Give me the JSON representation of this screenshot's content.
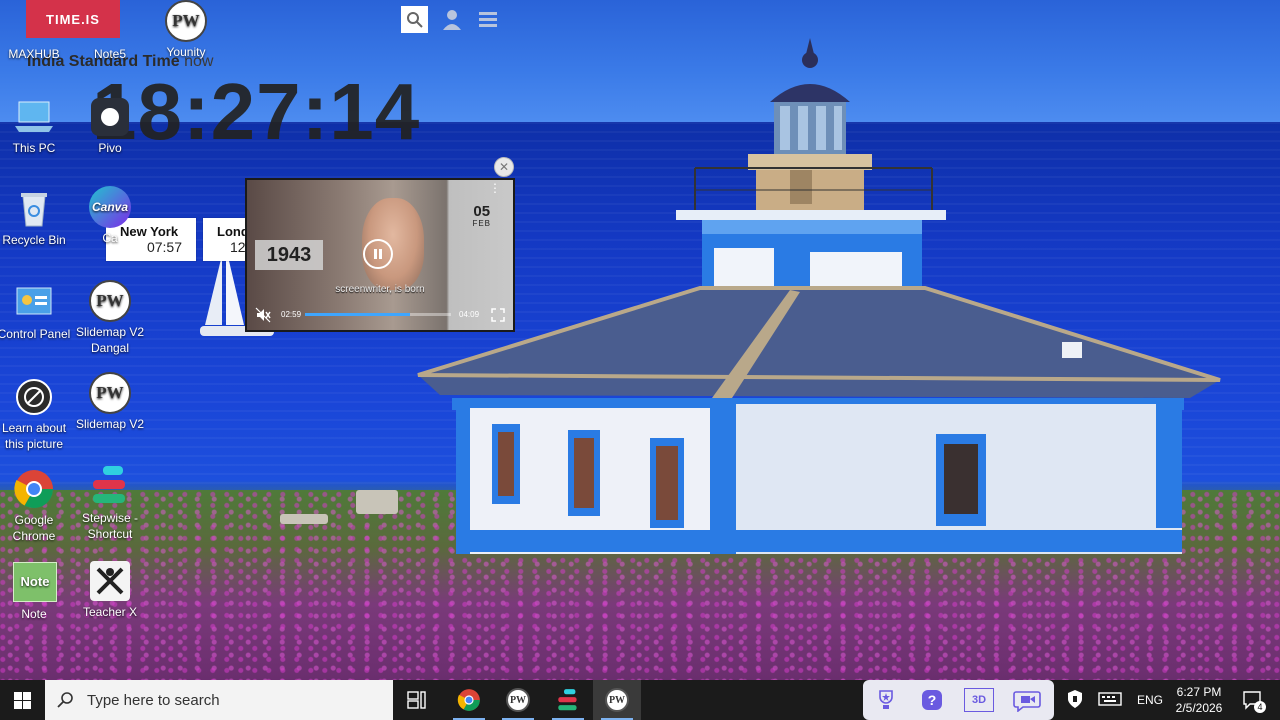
{
  "timeis": {
    "logo": "TIME.IS",
    "timezone": "India Standard Time",
    "now_label": "now",
    "clock": "18:27:14",
    "cities": [
      {
        "name": "New York",
        "time": "07:57"
      },
      {
        "name": "Lond",
        "time": "12"
      }
    ]
  },
  "desktop_icons": [
    {
      "label": "MAXHUB"
    },
    {
      "label": "Note5"
    },
    {
      "label": "Younity"
    },
    {
      "label": "This PC"
    },
    {
      "label": "Pivo"
    },
    {
      "label": "Recycle Bin"
    },
    {
      "label": "Ca"
    },
    {
      "label": "Control Panel"
    },
    {
      "label": "Slidemap V2 Dangal"
    },
    {
      "label": "Learn about this picture"
    },
    {
      "label": "Slidemap V2"
    },
    {
      "label": "Google Chrome"
    },
    {
      "label": "Stepwise - Shortcut"
    },
    {
      "label": "Note"
    },
    {
      "label": "Teacher X"
    }
  ],
  "canva_text": "Canva",
  "note_text": "Note",
  "video": {
    "year": "1943",
    "day": "05",
    "month": "FEB",
    "caption": "screenwriter, is born",
    "current_time": "02:59",
    "duration": "04:09",
    "progress": 0.72
  },
  "taskbar": {
    "search_placeholder": "Type here to search",
    "language": "ENG",
    "time": "6:27 PM",
    "date": "2/5/2026",
    "notification_count": "4",
    "widget_3d_label": "3D"
  },
  "colors": {
    "timeis_red": "#d4324a",
    "taskbar_bg": "#1b1b1b",
    "progress_blue": "#3ea6ff"
  }
}
